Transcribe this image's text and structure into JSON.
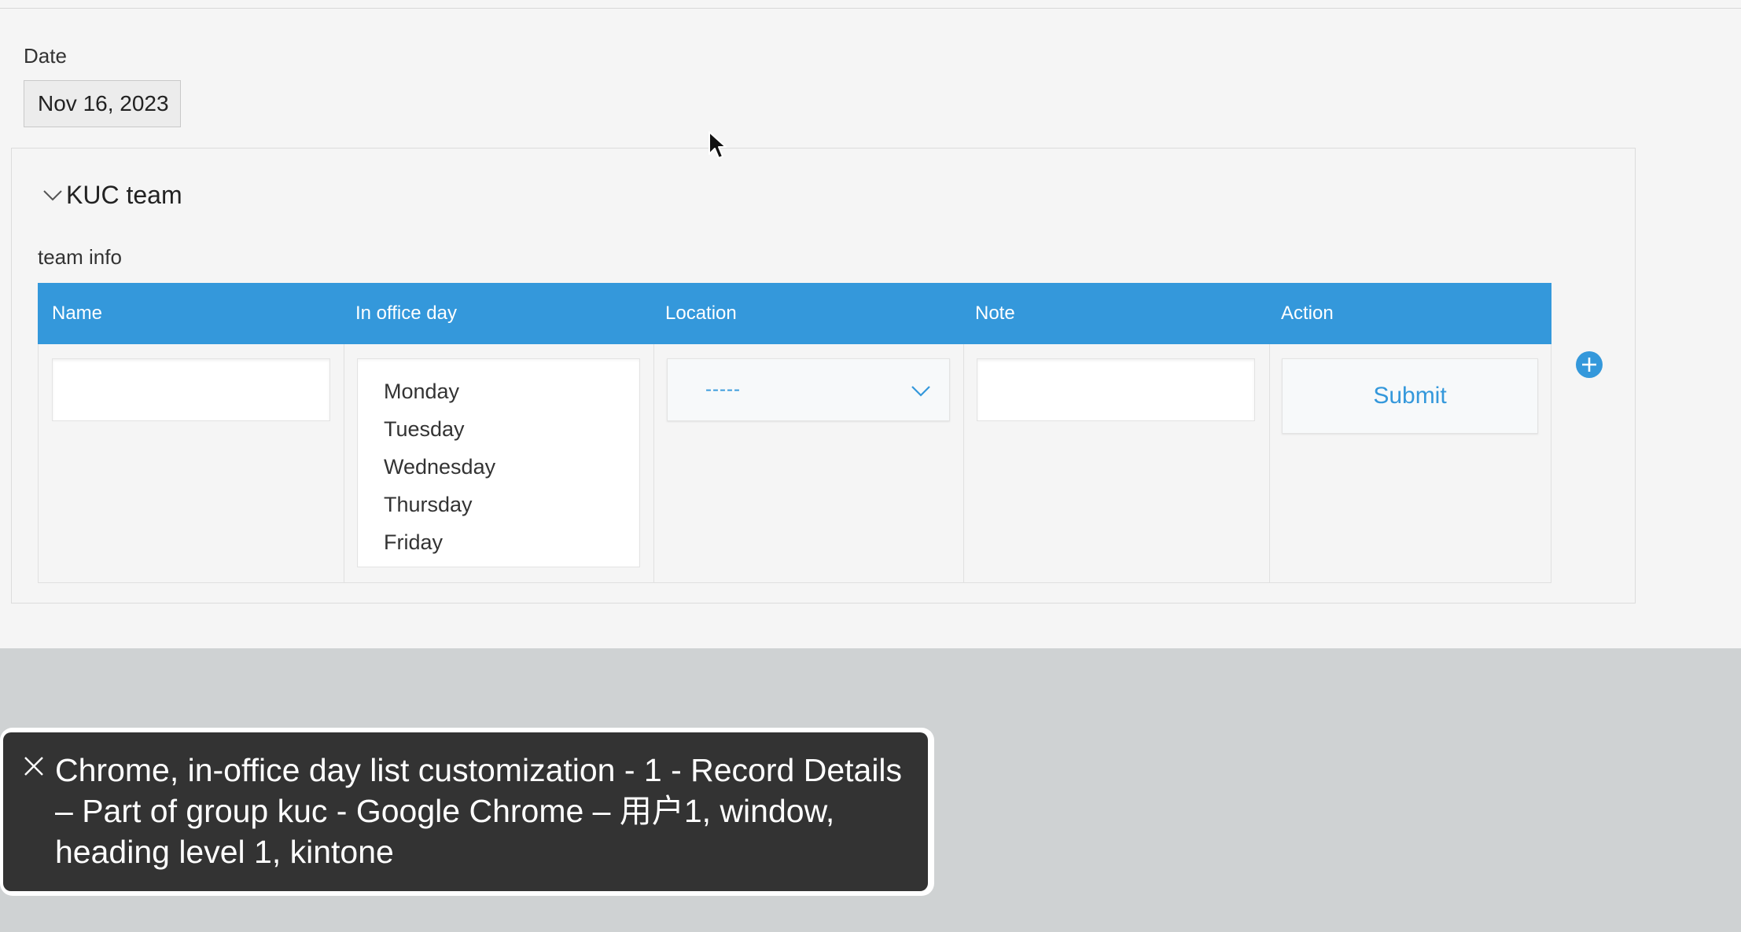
{
  "date_field": {
    "label": "Date",
    "value": "Nov 16, 2023"
  },
  "group": {
    "title": "KUC team",
    "toggle_icon": "chevron-down-icon"
  },
  "table": {
    "label": "team info",
    "headers": {
      "name": "Name",
      "in_office_day": "In office day",
      "location": "Location",
      "note": "Note",
      "action": "Action"
    },
    "row": {
      "name_value": "",
      "days": [
        "Monday",
        "Tuesday",
        "Wednesday",
        "Thursday",
        "Friday"
      ],
      "location_selected": "-----",
      "note_value": "",
      "action_label": "Submit"
    },
    "add_row_icon": "plus-circle-icon"
  },
  "tooltip": {
    "text": "Chrome, in-office day list customization - 1 - Record Details – Part of group kuc - Google Chrome – 用户1, window, heading level 1, kintone",
    "close_icon": "close-icon"
  },
  "colors": {
    "accent": "#3498db",
    "page_bg": "#f5f5f5",
    "footer_bg": "#cfd2d3",
    "tooltip_bg": "#333333"
  }
}
